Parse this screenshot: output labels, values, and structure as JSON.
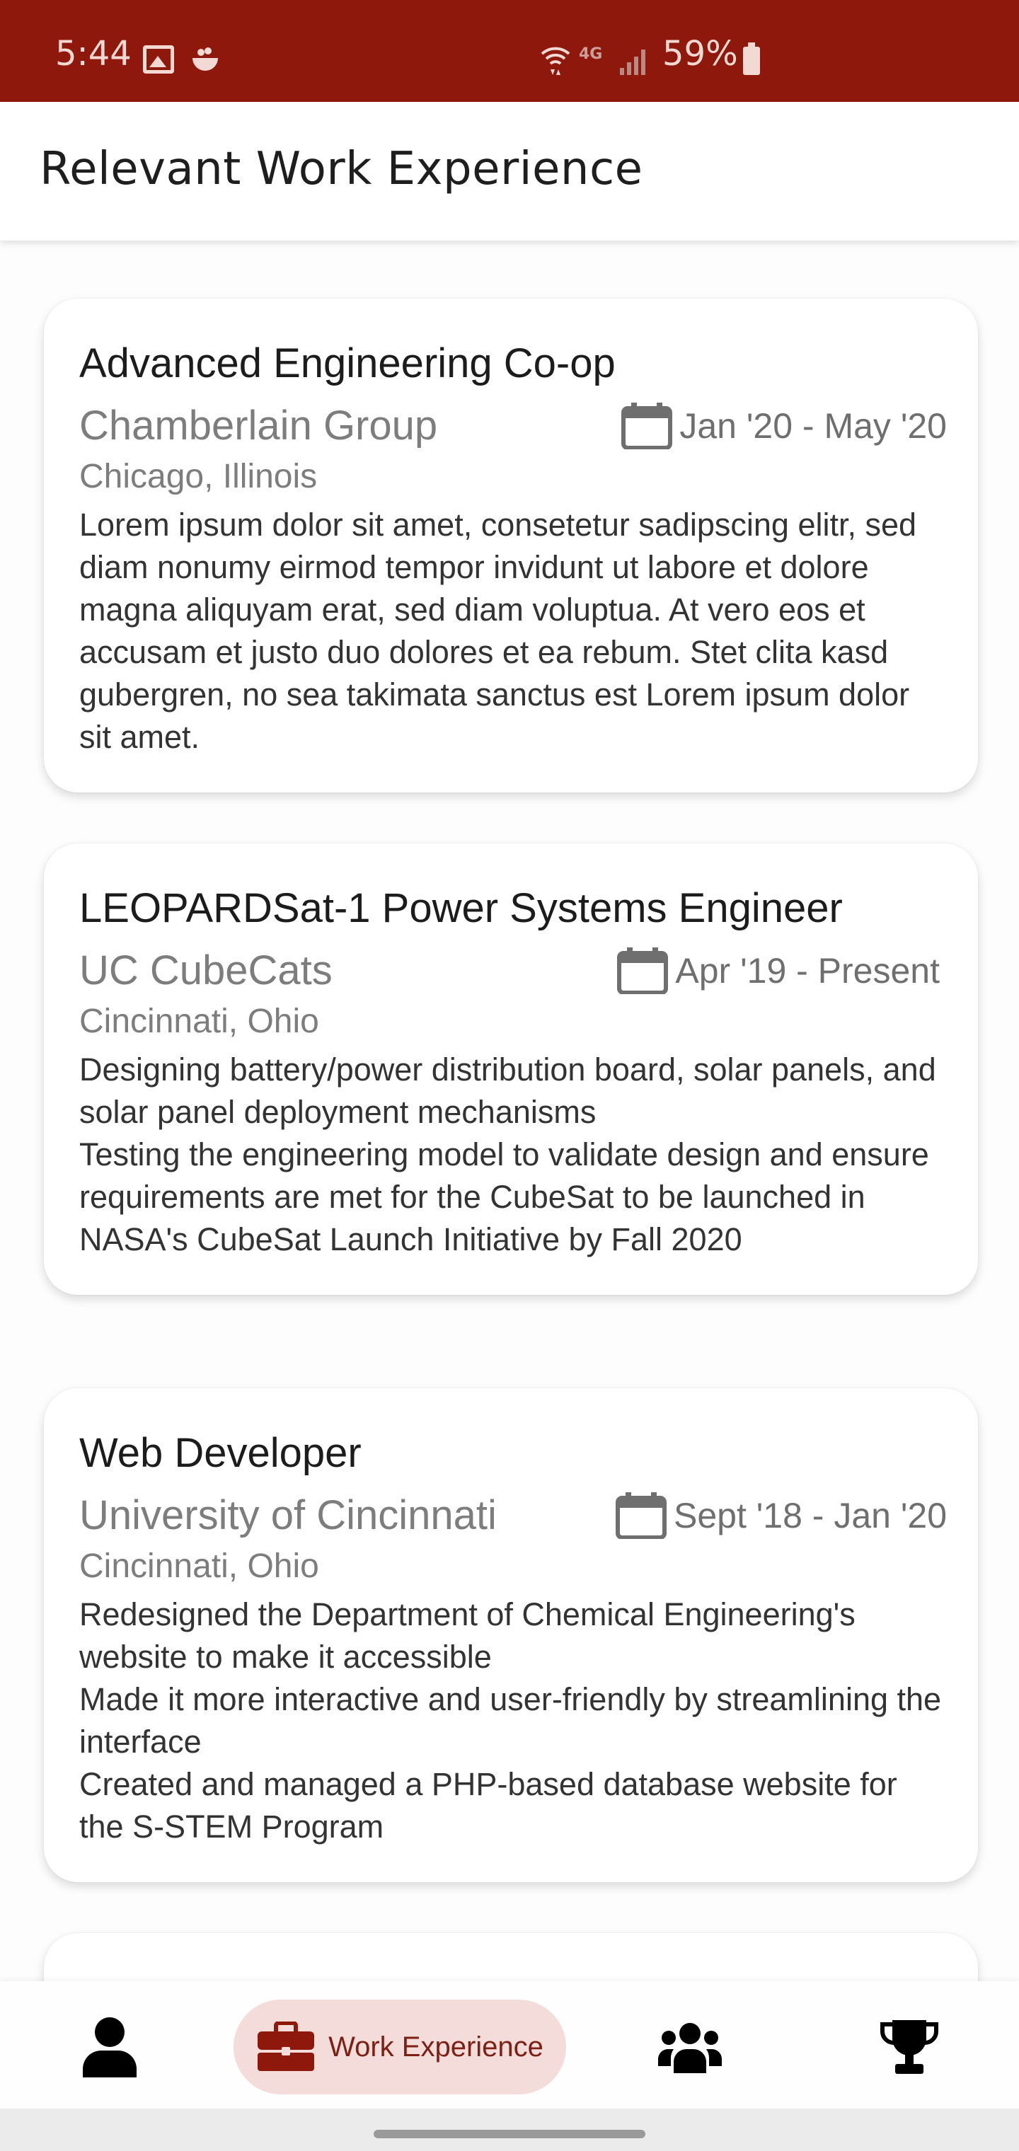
{
  "status_bar": {
    "time": "5:44",
    "network": "4G",
    "battery": "59%",
    "color": "#8f180c"
  },
  "header": {
    "title": "Relevant Work Experience"
  },
  "experiences": [
    {
      "title": "Advanced Engineering Co-op",
      "company": "Chamberlain Group",
      "dates": "Jan '20 - May '20",
      "location": "Chicago, Illinois",
      "description": "Lorem ipsum dolor sit amet, consetetur sadipscing elitr, sed diam nonumy eirmod tempor invidunt ut labore et dolore magna aliquyam erat, sed diam voluptua. At vero eos et accusam et justo duo dolores et ea rebum. Stet clita kasd gubergren, no sea takimata sanctus est Lorem ipsum dolor sit amet."
    },
    {
      "title": "LEOPARDSat-1 Power Systems Engineer",
      "company": "UC CubeCats",
      "dates": "Apr '19 - Present",
      "location": "Cincinnati, Ohio",
      "description": "Designing battery/power distribution board, solar panels, and solar panel deployment mechanisms\nTesting the engineering model to validate design and ensure requirements are met for the CubeSat to be launched in NASA's CubeSat Launch Initiative by Fall 2020"
    },
    {
      "title": "Web Developer",
      "company": "University of Cincinnati",
      "dates": "Sept '18 - Jan '20",
      "location": "Cincinnati, Ohio",
      "description": "Redesigned the Department of Chemical Engineering's website to make it accessible\nMade it more interactive and user-friendly by streamlining the interface\nCreated and managed a PHP-based database website for the S-STEM Program"
    }
  ],
  "bottom_nav": {
    "items": [
      {
        "icon": "person-icon"
      },
      {
        "icon": "briefcase-icon",
        "label": "Work Experience",
        "active": true
      },
      {
        "icon": "group-icon"
      },
      {
        "icon": "trophy-icon"
      }
    ],
    "accent": "#8f180c",
    "active_bg": "#f3dcda"
  }
}
